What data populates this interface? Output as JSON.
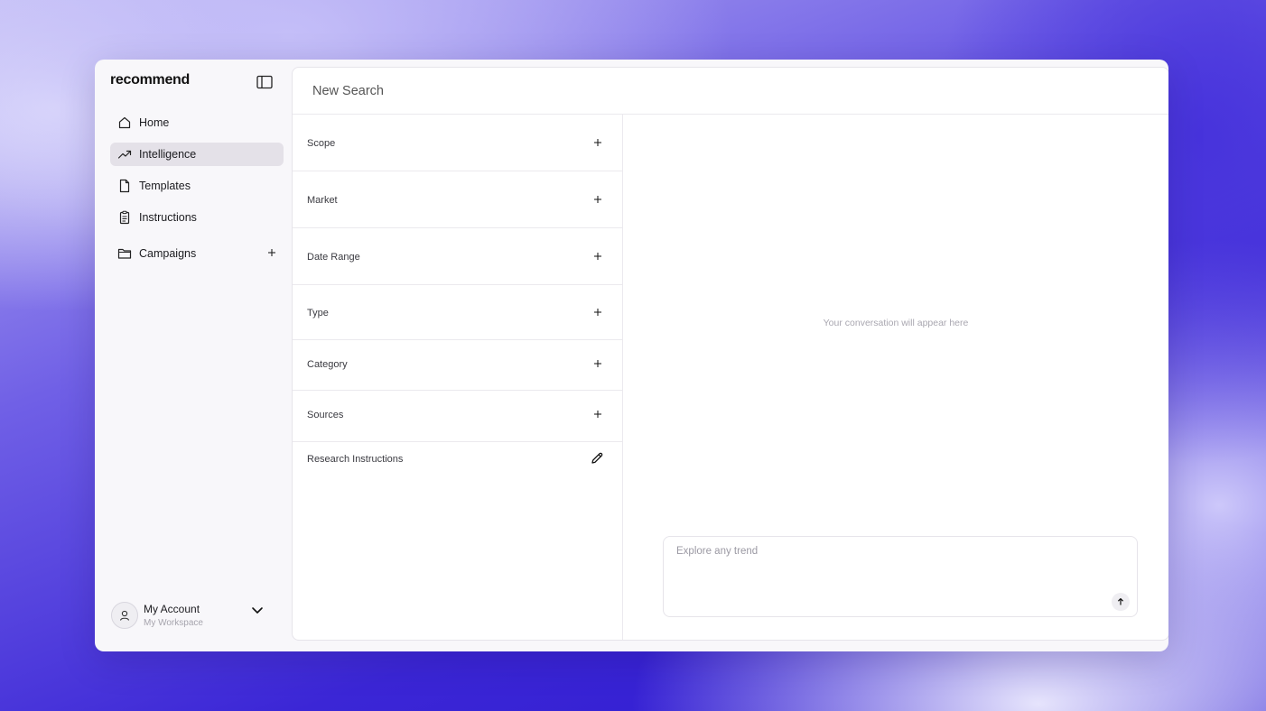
{
  "app": {
    "logo": "recommend"
  },
  "sidebar": {
    "toggle_icon": "sidebar-panel-icon",
    "items": [
      {
        "label": "Home",
        "icon": "home-icon",
        "active": false
      },
      {
        "label": "Intelligence",
        "icon": "trending-up-icon",
        "active": true
      },
      {
        "label": "Templates",
        "icon": "document-icon",
        "active": false
      },
      {
        "label": "Instructions",
        "icon": "clipboard-list-icon",
        "active": false
      }
    ],
    "group": {
      "label": "Campaigns",
      "icon": "folder-icon",
      "add_icon": "plus-icon"
    },
    "account": {
      "name": "My Account",
      "workspace": "My Workspace",
      "avatar_icon": "user-icon",
      "chevron_icon": "chevron-down-icon"
    }
  },
  "main": {
    "title": "New Search",
    "filters": [
      {
        "label": "Scope"
      },
      {
        "label": "Market"
      },
      {
        "label": "Date Range"
      },
      {
        "label": "Type"
      },
      {
        "label": "Category"
      },
      {
        "label": "Sources"
      }
    ],
    "research_instructions": {
      "label": "Research Instructions",
      "icon": "pencil-icon"
    },
    "conversation": {
      "empty_text": "Your conversation will appear here"
    },
    "composer": {
      "placeholder": "Explore any trend",
      "send_icon": "arrow-up-icon"
    }
  },
  "colors": {
    "active_nav_bg": "#e4e1e8",
    "window_bg": "#f8f7fa",
    "panel_bg": "#ffffff",
    "background_accent": "#3b26d6"
  }
}
